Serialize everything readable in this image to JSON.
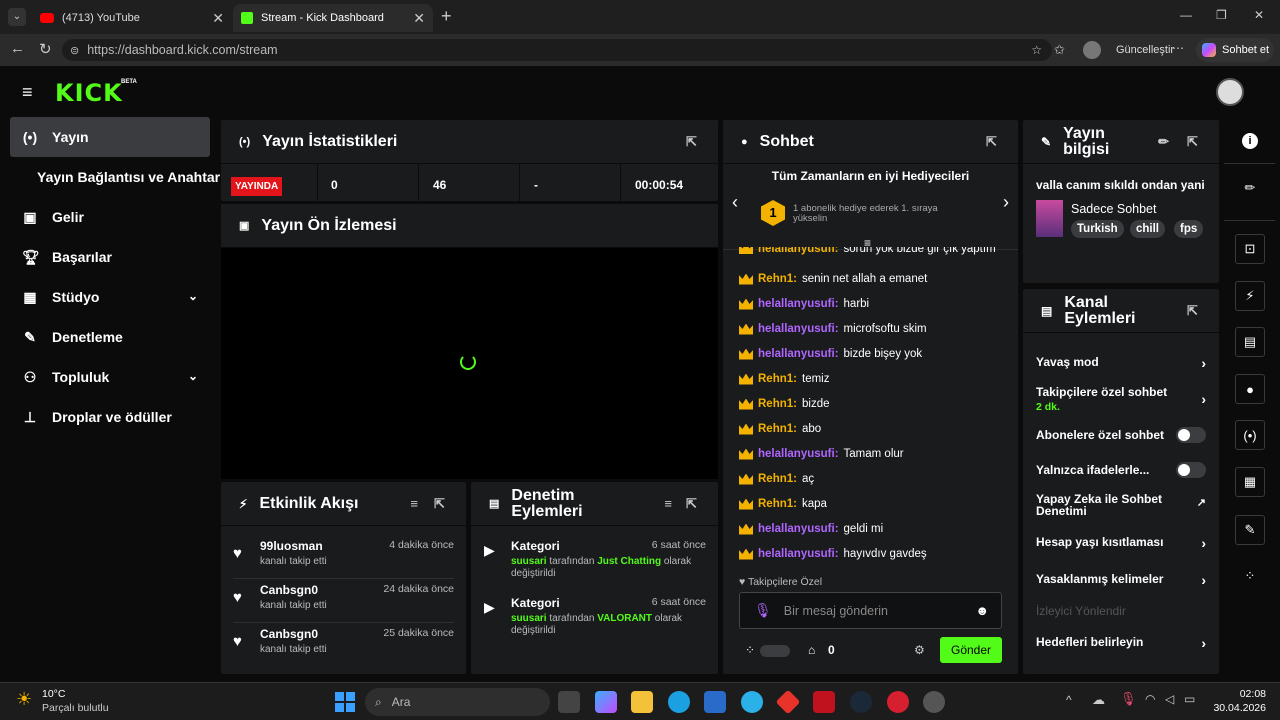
{
  "browser": {
    "tabs": [
      {
        "label": "(4713) YouTube",
        "active": false
      },
      {
        "label": "Stream - Kick Dashboard",
        "active": true
      }
    ],
    "url": "https://dashboard.kick.com/stream",
    "update_label": "Güncelleştir",
    "copilot_label": "Sohbet et"
  },
  "brand": {
    "logo": "KICK",
    "beta": "BETA",
    "accent": "#53fc18"
  },
  "sidebar": {
    "items": [
      {
        "label": "Yayın",
        "icon": "broadcast-icon"
      },
      {
        "label": "Yayın Bağlantısı ve Anahtarı",
        "icon": ""
      },
      {
        "label": "Gelir",
        "icon": "dollar-icon"
      },
      {
        "label": "Başarılar",
        "icon": "trophy-icon"
      },
      {
        "label": "Stüdyo",
        "icon": "studio-icon"
      },
      {
        "label": "Denetleme",
        "icon": "wrench-icon"
      },
      {
        "label": "Topluluk",
        "icon": "people-icon"
      },
      {
        "label": "Droplar ve ödüller",
        "icon": "drops-icon"
      }
    ]
  },
  "stats": {
    "title": "Yayın İstatistikleri",
    "live_badge": "YAYINDA",
    "values": [
      "0",
      "46",
      "-",
      "00:00:54"
    ]
  },
  "preview": {
    "title": "Yayın Ön İzlemesi"
  },
  "activity": {
    "title": "Etkinlik Akışı",
    "items": [
      {
        "user": "99luosman",
        "action": "kanalı takip etti",
        "time": "4 dakika önce"
      },
      {
        "user": "Canbsgn0",
        "action": "kanalı takip etti",
        "time": "24 dakika önce"
      },
      {
        "user": "Canbsgn0",
        "action": "kanalı takip etti",
        "time": "25 dakika önce"
      }
    ]
  },
  "moderation": {
    "title": "Denetim Eylemleri",
    "items": [
      {
        "type": "Kategori",
        "time": "6 saat önce",
        "user": "suusari",
        "mid": "tarafından",
        "category": "Just Chatting",
        "tail": "olarak değiştirildi"
      },
      {
        "type": "Kategori",
        "time": "6 saat önce",
        "user": "suusari",
        "mid": "tarafından",
        "category": "VALORANT",
        "tail": "olarak değiştirildi"
      }
    ]
  },
  "chat": {
    "title": "Sohbet",
    "gifters_title": "Tüm Zamanların en iyi Hediyecileri",
    "gifter_rank": "1",
    "gifter_text": "1 abonelik hediye ederek 1. sıraya yükselin",
    "partial_line": "sorun yok bizde gir çık yaptım",
    "messages": [
      {
        "user": "Rehn1",
        "text": "senin net allah a emanet",
        "color": "#f3b200"
      },
      {
        "user": "helallanyusufi",
        "text": "harbi",
        "color": "#b066ff"
      },
      {
        "user": "helallanyusufi",
        "text": "microfsoftu skim",
        "color": "#b066ff"
      },
      {
        "user": "helallanyusufi",
        "text": "bizde bişey yok",
        "color": "#b066ff"
      },
      {
        "user": "Rehn1",
        "text": "temiz",
        "color": "#f3b200"
      },
      {
        "user": "Rehn1",
        "text": "bizde",
        "color": "#f3b200"
      },
      {
        "user": "Rehn1",
        "text": "abo",
        "color": "#f3b200"
      },
      {
        "user": "helallanyusufi",
        "text": "Tamam olur",
        "color": "#b066ff"
      },
      {
        "user": "Rehn1",
        "text": "aç",
        "color": "#f3b200"
      },
      {
        "user": "Rehn1",
        "text": "kapa",
        "color": "#f3b200"
      },
      {
        "user": "helallanyusufi",
        "text": "geldi mi",
        "color": "#b066ff"
      },
      {
        "user": "helallanyusufi",
        "text": "hayıvdıv gavdeş",
        "color": "#b066ff"
      }
    ],
    "followers_only": "Takipçilere Özel",
    "input_placeholder": "Bir mesaj gönderin",
    "count": "0",
    "send_label": "Gönder"
  },
  "stream_info": {
    "title": "Yayın bilgisi",
    "stream_title": "valla canım sıkıldı ondan yani",
    "category": "Sadece Sohbet",
    "tags": [
      "Turkish",
      "chill",
      "fps"
    ]
  },
  "channel_actions": {
    "title": "Kanal Eylemleri",
    "slow_mode": "Yavaş mod",
    "followers_chat": "Takipçilere özel sohbet",
    "followers_chat_value": "2 dk.",
    "subs_chat": "Abonelere özel sohbet",
    "emotes_only": "Yalnızca ifadelerle...",
    "ai_mod": "Yapay Zeka ile Sohbet Denetimi",
    "age_restrict": "Hesap yaşı kısıtlaması",
    "banned_words": "Yasaklanmış kelimeler",
    "viewer_redirect": "İzleyici Yönlendir",
    "goals": "Hedefleri belirleyin"
  },
  "taskbar": {
    "weather_temp": "10°C",
    "weather_desc": "Parçalı bulutlu",
    "search_placeholder": "Ara",
    "time": "02:08",
    "date": "30.04.2026"
  }
}
